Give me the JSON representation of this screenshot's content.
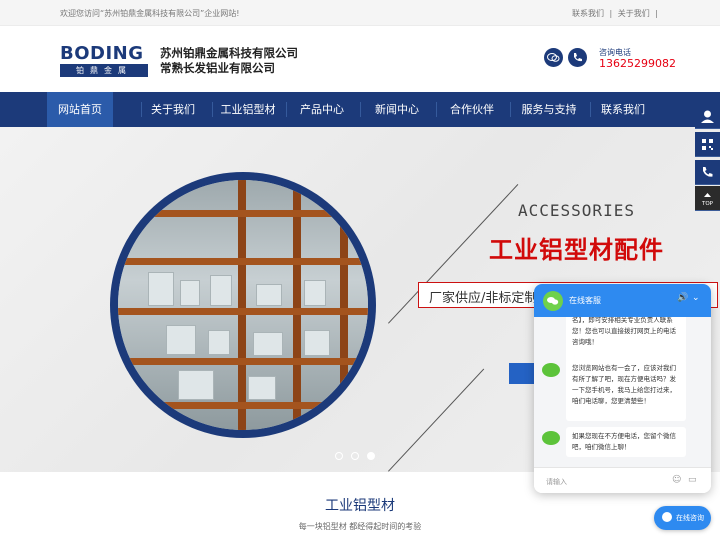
{
  "topbar": {
    "welcome": "欢迎您访问“苏州铂鼎金属科技有限公司”企业网站!",
    "links": [
      "联系我们",
      "|",
      "关于我们",
      "|"
    ]
  },
  "header": {
    "logo_word": "BODING",
    "logo_sub": "铂鼎金属",
    "company_line1": "苏州铂鼎金属科技有限公司",
    "company_line2": "常熟长发铝业有限公司",
    "phone_label": "咨询电话",
    "phone_number": "13625299082"
  },
  "nav": {
    "items": [
      "网站首页",
      "关于我们",
      "工业铝型材",
      "产品中心",
      "新闻中心",
      "合作伙伴",
      "服务与支持",
      "联系我们"
    ],
    "active_index": 0
  },
  "banner": {
    "english": "ACCESSORIES",
    "chinese": "工业铝型材配件",
    "tagline": "厂家供应/非标定制/品质保证/原充",
    "slides": 3,
    "active_slide": 2
  },
  "section": {
    "title": "工业铝型材",
    "subtitle": "每一块铝型材 都经得起时间的考验"
  },
  "side_float": {
    "icons": [
      "user-icon",
      "qrcode-icon",
      "phone-icon"
    ],
    "top_label": "TOP"
  },
  "chat": {
    "title": "在线客服",
    "messages": [
      "名】，即可安排相关专业负责人联系您！您也可以直接拨打网页上的电话咨询哦！",
      "您浏览网站也有一会了，应该对我们有所了解了吧，现在方便电话吗？发一下您手机号，我马上给您打过来，咱们电话聊，您更清楚些！",
      "如果您现在不方便电话，您留个微信吧，咱们微信上聊！"
    ],
    "input_placeholder": "请输入",
    "consult_button": "在线咨询"
  },
  "colors": {
    "brand_navy": "#1c3a7a",
    "nav_active": "#2b5baa",
    "accent_red": "#d10a0a",
    "chat_blue": "#2e8af0"
  }
}
